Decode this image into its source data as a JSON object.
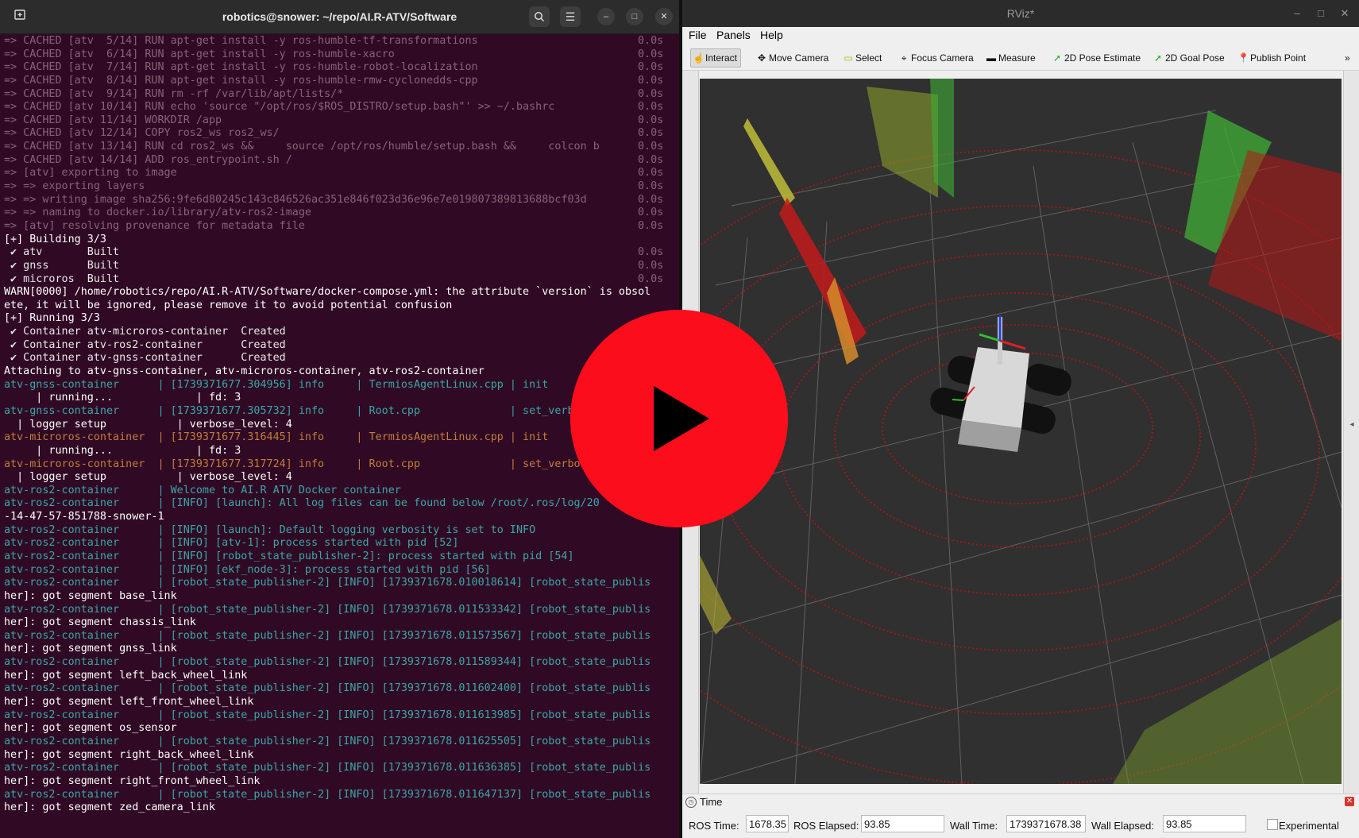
{
  "terminal": {
    "title": "robotics@snower: ~/repo/AI.R-ATV/Software",
    "icons": [
      "new-tab-icon",
      "search-icon",
      "hamburger-menu-icon",
      "minimize-icon",
      "maximize-icon",
      "close-icon"
    ],
    "lines": [
      {
        "t": "=> CACHED [atv  5/14] RUN apt-get install -y ros-humble-tf-transformations",
        "time": "0.0s",
        "style": "dim"
      },
      {
        "t": "=> CACHED [atv  6/14] RUN apt-get install -y ros-humble-xacro",
        "time": "0.0s",
        "style": "dim"
      },
      {
        "t": "=> CACHED [atv  7/14] RUN apt-get install -y ros-humble-robot-localization",
        "time": "0.0s",
        "style": "dim"
      },
      {
        "t": "=> CACHED [atv  8/14] RUN apt-get install -y ros-humble-rmw-cyclonedds-cpp",
        "time": "0.0s",
        "style": "dim"
      },
      {
        "t": "=> CACHED [atv  9/14] RUN rm -rf /var/lib/apt/lists/*",
        "time": "0.0s",
        "style": "dim"
      },
      {
        "t": "=> CACHED [atv 10/14] RUN echo 'source \"/opt/ros/$ROS_DISTRO/setup.bash\"' >> ~/.bashrc",
        "time": "0.0s",
        "style": "dim"
      },
      {
        "t": "=> CACHED [atv 11/14] WORKDIR /app",
        "time": "0.0s",
        "style": "dim"
      },
      {
        "t": "=> CACHED [atv 12/14] COPY ros2_ws ros2_ws/",
        "time": "0.0s",
        "style": "dim"
      },
      {
        "t": "=> CACHED [atv 13/14] RUN cd ros2_ws &&     source /opt/ros/humble/setup.bash &&     colcon b",
        "time": "0.0s",
        "style": "dim"
      },
      {
        "t": "=> CACHED [atv 14/14] ADD ros_entrypoint.sh /",
        "time": "0.0s",
        "style": "dim"
      },
      {
        "t": "=> [atv] exporting to image",
        "time": "0.0s",
        "style": "dim"
      },
      {
        "t": "=> => exporting layers",
        "time": "0.0s",
        "style": "dim"
      },
      {
        "t": "=> => writing image sha256:9fe6d80245c143c846526ac351e846f023d36e96e7e019807389813688bcf03d",
        "time": "0.0s",
        "style": "dim"
      },
      {
        "t": "=> => naming to docker.io/library/atv-ros2-image",
        "time": "0.0s",
        "style": "dim"
      },
      {
        "t": "=> [atv] resolving provenance for metadata file",
        "time": "0.0s",
        "style": "dim"
      },
      {
        "t": "[+] Building 3/3",
        "time": "",
        "style": "white"
      },
      {
        "t": " ✔ atv       Built",
        "time": "0.0s",
        "style": "built"
      },
      {
        "t": " ✔ gnss      Built",
        "time": "0.0s",
        "style": "built"
      },
      {
        "t": " ✔ microros  Built",
        "time": "0.0s",
        "style": "built"
      },
      {
        "t": "WARN[0000] /home/robotics/repo/AI.R-ATV/Software/docker-compose.yml: the attribute `version` is obsol",
        "time": "",
        "style": "warn"
      },
      {
        "t": "ete, it will be ignored, please remove it to avoid potential confusion",
        "time": "",
        "style": "white"
      },
      {
        "t": "[+] Running 3/3",
        "time": "",
        "style": "white"
      },
      {
        "t": " ✔ Container atv-microros-container  Created",
        "time": "",
        "style": "created"
      },
      {
        "t": " ✔ Container atv-ros2-container      Created",
        "time": "",
        "style": "created"
      },
      {
        "t": " ✔ Container atv-gnss-container      Created",
        "time": "",
        "style": "created"
      },
      {
        "t": "Attaching to atv-gnss-container, atv-microros-container, atv-ros2-container",
        "time": "",
        "style": "white"
      },
      {
        "t": "atv-gnss-container      | [1739371677.304956] info     | TermiosAgentLinux.cpp | init",
        "time": "",
        "style": "gnss"
      },
      {
        "t": "     | running...             | fd: 3",
        "time": "",
        "style": "white"
      },
      {
        "t": "atv-gnss-container      | [1739371677.305732] info     | Root.cpp              | set_verb",
        "time": "",
        "style": "gnss"
      },
      {
        "t": "  | logger setup           | verbose_level: 4",
        "time": "",
        "style": "white"
      },
      {
        "t": "atv-microros-container  | [1739371677.316445] info     | TermiosAgentLinux.cpp | init",
        "time": "",
        "style": "micro"
      },
      {
        "t": "     | running...             | fd: 3",
        "time": "",
        "style": "white"
      },
      {
        "t": "atv-microros-container  | [1739371677.317724] info     | Root.cpp              | set_verbos",
        "time": "",
        "style": "micro"
      },
      {
        "t": "  | logger setup           | verbose_level: 4",
        "time": "",
        "style": "white"
      },
      {
        "t": "atv-ros2-container      | Welcome to AI.R ATV Docker container",
        "time": "",
        "style": "ros2"
      },
      {
        "t": "atv-ros2-container      | [INFO] [launch]: All log files can be found below /root/.ros/log/20",
        "time": "",
        "style": "ros2"
      },
      {
        "t": "-14-47-57-851788-snower-1",
        "time": "",
        "style": "white"
      },
      {
        "t": "atv-ros2-container      | [INFO] [launch]: Default logging verbosity is set to INFO",
        "time": "",
        "style": "ros2"
      },
      {
        "t": "atv-ros2-container      | [INFO] [atv-1]: process started with pid [52]",
        "time": "",
        "style": "ros2"
      },
      {
        "t": "atv-ros2-container      | [INFO] [robot_state_publisher-2]: process started with pid [54]",
        "time": "",
        "style": "ros2"
      },
      {
        "t": "atv-ros2-container      | [INFO] [ekf_node-3]: process started with pid [56]",
        "time": "",
        "style": "ros2"
      },
      {
        "t": "atv-ros2-container      | [robot_state_publisher-2] [INFO] [1739371678.010018614] [robot_state_publis",
        "time": "",
        "style": "ros2"
      },
      {
        "t": "her]: got segment base_link",
        "time": "",
        "style": "white"
      },
      {
        "t": "atv-ros2-container      | [robot_state_publisher-2] [INFO] [1739371678.011533342] [robot_state_publis",
        "time": "",
        "style": "ros2"
      },
      {
        "t": "her]: got segment chassis_link",
        "time": "",
        "style": "white"
      },
      {
        "t": "atv-ros2-container      | [robot_state_publisher-2] [INFO] [1739371678.011573567] [robot_state_publis",
        "time": "",
        "style": "ros2"
      },
      {
        "t": "her]: got segment gnss_link",
        "time": "",
        "style": "white"
      },
      {
        "t": "atv-ros2-container      | [robot_state_publisher-2] [INFO] [1739371678.011589344] [robot_state_publis",
        "time": "",
        "style": "ros2"
      },
      {
        "t": "her]: got segment left_back_wheel_link",
        "time": "",
        "style": "white"
      },
      {
        "t": "atv-ros2-container      | [robot_state_publisher-2] [INFO] [1739371678.011602400] [robot_state_publis",
        "time": "",
        "style": "ros2"
      },
      {
        "t": "her]: got segment left_front_wheel_link",
        "time": "",
        "style": "white"
      },
      {
        "t": "atv-ros2-container      | [robot_state_publisher-2] [INFO] [1739371678.011613985] [robot_state_publis",
        "time": "",
        "style": "ros2"
      },
      {
        "t": "her]: got segment os_sensor",
        "time": "",
        "style": "white"
      },
      {
        "t": "atv-ros2-container      | [robot_state_publisher-2] [INFO] [1739371678.011625505] [robot_state_publis",
        "time": "",
        "style": "ros2"
      },
      {
        "t": "her]: got segment right_back_wheel_link",
        "time": "",
        "style": "white"
      },
      {
        "t": "atv-ros2-container      | [robot_state_publisher-2] [INFO] [1739371678.011636385] [robot_state_publis",
        "time": "",
        "style": "ros2"
      },
      {
        "t": "her]: got segment right_front_wheel_link",
        "time": "",
        "style": "white"
      },
      {
        "t": "atv-ros2-container      | [robot_state_publisher-2] [INFO] [1739371678.011647137] [robot_state_publis",
        "time": "",
        "style": "ros2"
      },
      {
        "t": "her]: got segment zed_camera_link",
        "time": "",
        "style": "white"
      }
    ]
  },
  "rviz": {
    "title": "RViz*",
    "window_controls": [
      "minimize-icon",
      "maximize-icon",
      "close-icon"
    ],
    "menu": [
      "File",
      "Panels",
      "Help"
    ],
    "tools": [
      {
        "label": "Interact",
        "icon": "interact-icon",
        "active": true
      },
      {
        "label": "Move Camera",
        "icon": "move-camera-icon",
        "active": false
      },
      {
        "label": "Select",
        "icon": "select-icon",
        "active": false
      },
      {
        "label": "Focus Camera",
        "icon": "focus-camera-icon",
        "active": false
      },
      {
        "label": "Measure",
        "icon": "measure-icon",
        "active": false
      },
      {
        "label": "2D Pose Estimate",
        "icon": "pose-estimate-icon",
        "active": false
      },
      {
        "label": "2D Goal Pose",
        "icon": "goal-pose-icon",
        "active": false
      },
      {
        "label": "Publish Point",
        "icon": "publish-point-icon",
        "active": false
      }
    ],
    "time_panel": {
      "title": "Time",
      "ros_time_label": "ROS Time:",
      "ros_time": "1678.35",
      "ros_elapsed_label": "ROS Elapsed:",
      "ros_elapsed": "93.85",
      "wall_time_label": "Wall Time:",
      "wall_time": "1739371678.38",
      "wall_elapsed_label": "Wall Elapsed:",
      "wall_elapsed": "93.85",
      "experimental_label": "Experimental"
    },
    "colors": {
      "viewport_bg": "#303030",
      "grid": "#9a9a9a",
      "pointcloud_red": "#c21a1a",
      "pointcloud_green": "#39c93c",
      "pointcloud_yellow": "#d8d83a",
      "play_red": "#fc0d1b"
    }
  },
  "overlay": {
    "icon": "play-button-icon"
  }
}
